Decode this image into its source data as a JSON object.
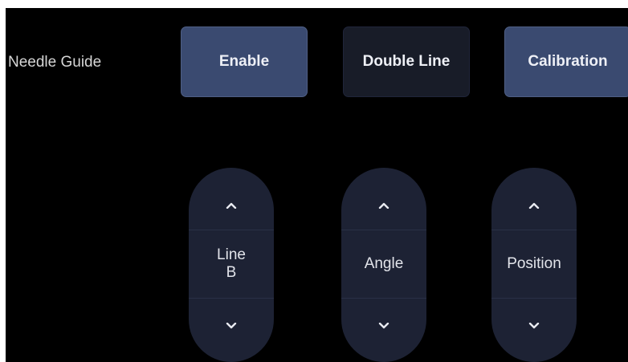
{
  "needle_guide": {
    "label": "Needle Guide",
    "buttons": {
      "enable": {
        "label": "Enable",
        "state": "active"
      },
      "double_line": {
        "label": "Double Line",
        "state": "inactive"
      },
      "calibration": {
        "label": "Calibration",
        "state": "active"
      }
    }
  },
  "steppers": {
    "line": {
      "label_line1": "Line",
      "label_line2": "B"
    },
    "angle": {
      "label": "Angle"
    },
    "position": {
      "label": "Position"
    }
  },
  "icons": {
    "up": "chevron-up-icon",
    "down": "chevron-down-icon"
  },
  "colors": {
    "background": "#000000",
    "active_button": "#3a4a70",
    "inactive_button": "#181c28",
    "stepper": "#1d2234",
    "text": "#eef0f6"
  }
}
